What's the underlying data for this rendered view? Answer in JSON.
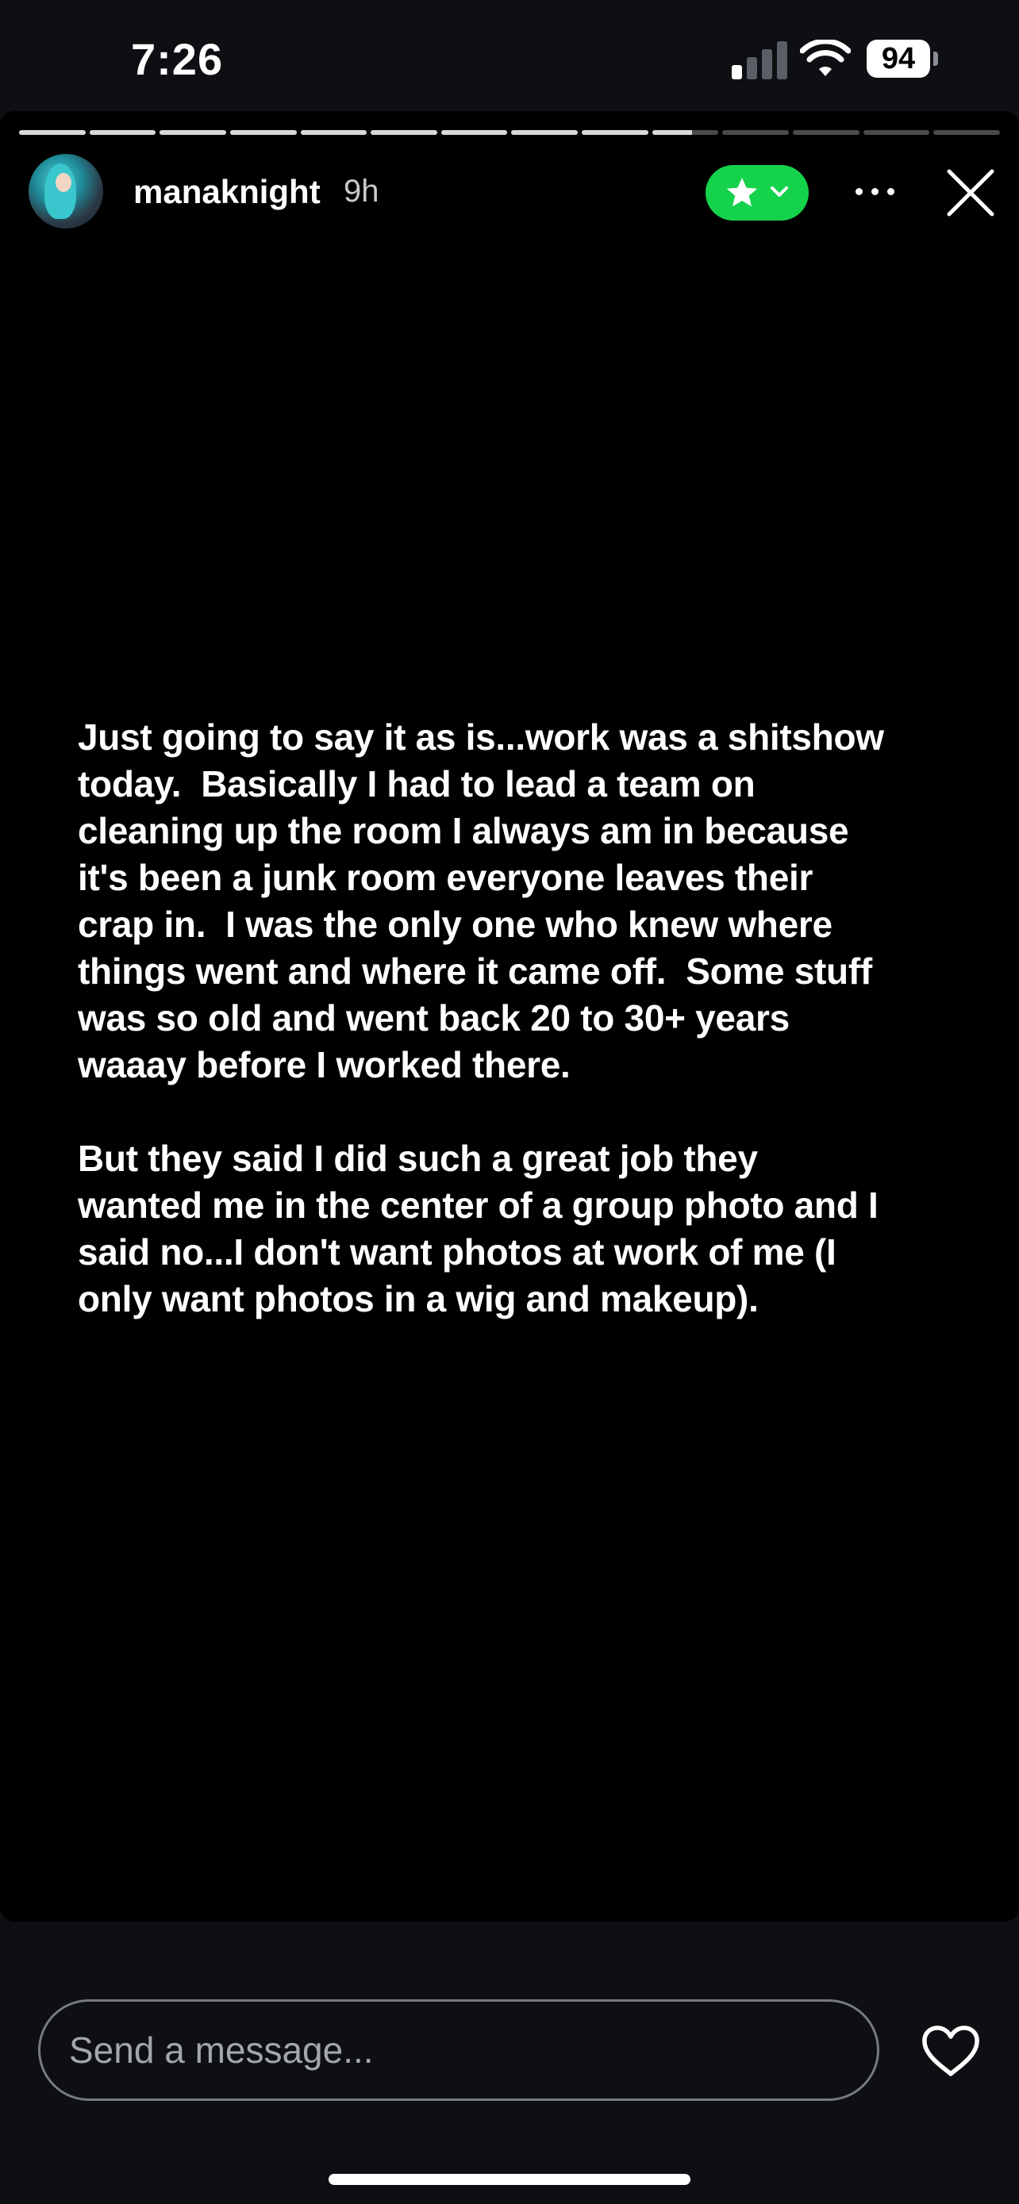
{
  "status_bar": {
    "time": "7:26",
    "battery_level": "94",
    "signal_bars_active": 1,
    "signal_bars_total": 4
  },
  "story": {
    "segments_total": 14,
    "segments_completed": 9,
    "current_segment_progress": 0.6,
    "username": "manaknight",
    "time_ago": "9h",
    "text": "Just going to say it as is...work was a shitshow\ntoday.  Basically I had to lead a team on\ncleaning up the room I always am in because\nit's been a junk room everyone leaves their\ncrap in.  I was the only one who knew where\nthings went and where it came off.  Some stuff\nwas so old and went back 20 to 30+ years\nwaaay before I worked there.\n\nBut they said I did such a great job they\nwanted me in the center of a group photo and I\nsaid no...I don't want photos at work of me (I\nonly want photos in a wig and makeup).",
    "icons": {
      "favorite": "star-icon",
      "favorite_menu": "chevron-down-icon",
      "more": "more-horizontal-icon",
      "close": "close-icon"
    }
  },
  "composer": {
    "placeholder": "Send a message...",
    "like_icon": "heart-icon"
  },
  "colors": {
    "background": "#0d0f13",
    "story_background": "#000000",
    "close_friends_green": "#15d24b",
    "progress_active": "#d8d8d8",
    "progress_inactive": "#4a4a4a"
  }
}
